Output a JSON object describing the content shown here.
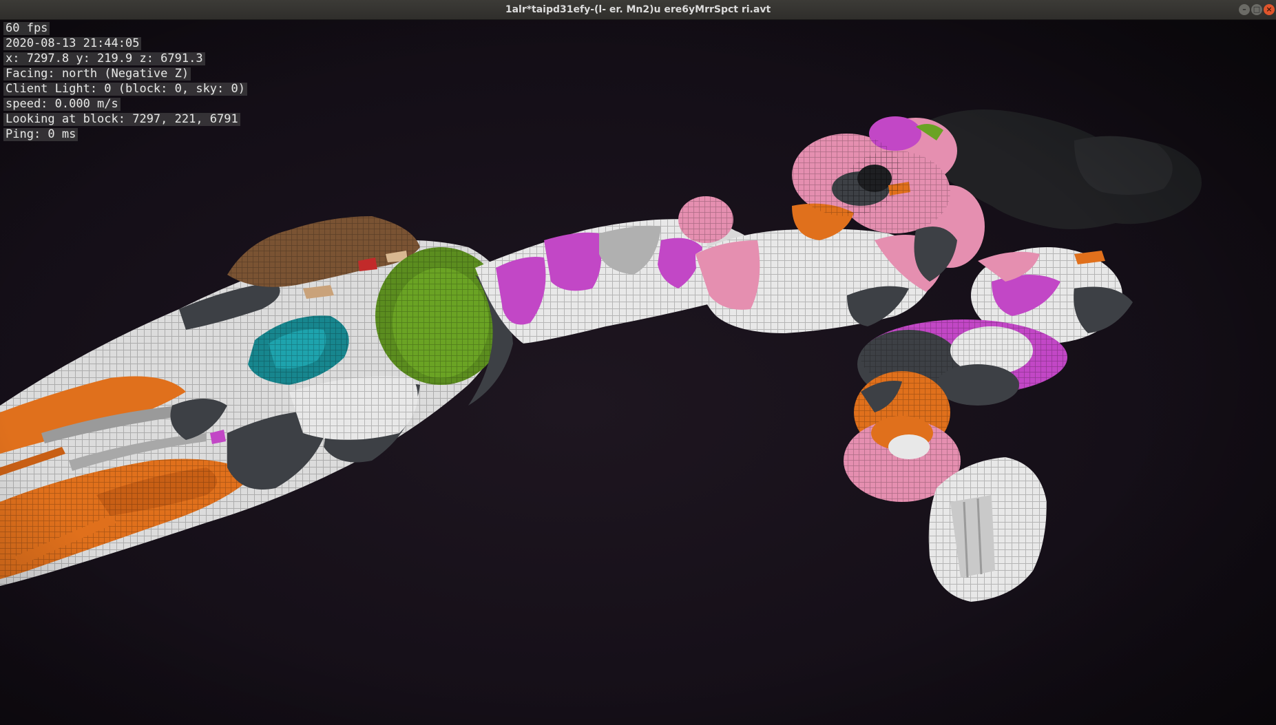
{
  "window": {
    "title": "1alr*taipd31efy-(l- er. Mn2)u ere6yMrrSpct  ri.avt",
    "minimize_glyph": "–",
    "maximize_glyph": "□",
    "close_glyph": "×"
  },
  "hud": {
    "lines": [
      "60 fps",
      "2020-08-13 21:44:05",
      "x: 7297.8 y: 219.9 z: 6791.3",
      "Facing: north (Negative Z)",
      "Client Light: 0 (block: 0, sky: 0)",
      "speed: 0.000 m/s",
      "Looking at block: 7297, 221, 6791",
      "Ping: 0 ms"
    ]
  },
  "colors": {
    "void": "#140f16",
    "orange": "#e0701c",
    "white": "#e8e8e8",
    "light_gray": "#b9b9b9",
    "dark_gray": "#3d4045",
    "magenta": "#c247c6",
    "pink": "#e58fb0",
    "lime": "#6aa324",
    "cyan": "#17868e",
    "brown": "#7a5333",
    "red": "#c22a2a"
  }
}
